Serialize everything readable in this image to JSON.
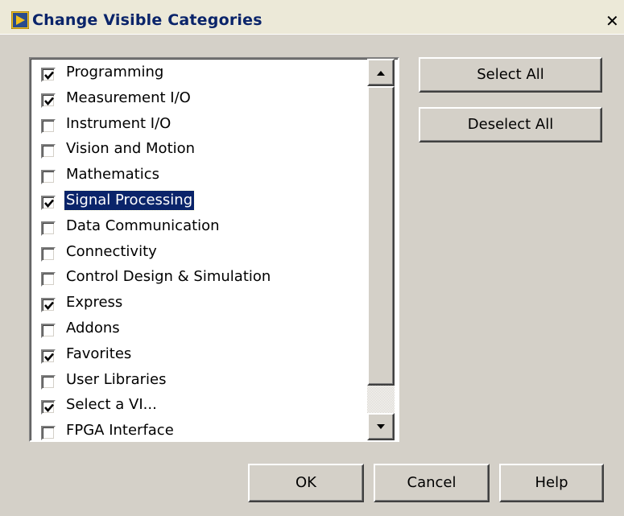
{
  "window": {
    "title": "Change Visible Categories",
    "close_glyph": "✕"
  },
  "categories": [
    {
      "label": "Programming",
      "checked": true
    },
    {
      "label": "Measurement I/O",
      "checked": true
    },
    {
      "label": "Instrument I/O",
      "checked": false
    },
    {
      "label": "Vision and Motion",
      "checked": false
    },
    {
      "label": "Mathematics",
      "checked": false
    },
    {
      "label": "Signal Processing",
      "checked": true,
      "selected": true
    },
    {
      "label": "Data Communication",
      "checked": false
    },
    {
      "label": "Connectivity",
      "checked": false
    },
    {
      "label": "Control Design & Simulation",
      "checked": false
    },
    {
      "label": "Express",
      "checked": true
    },
    {
      "label": "Addons",
      "checked": false
    },
    {
      "label": "Favorites",
      "checked": true
    },
    {
      "label": "User Libraries",
      "checked": false
    },
    {
      "label": "Select a VI...",
      "checked": true
    },
    {
      "label": "FPGA Interface",
      "checked": false
    }
  ],
  "side_buttons": {
    "select_all": "Select All",
    "deselect_all": "Deselect All"
  },
  "bottom_buttons": {
    "ok": "OK",
    "cancel": "Cancel",
    "help": "Help"
  },
  "colors": {
    "dialog_bg": "#d4d0c8",
    "selection": "#0a246a",
    "title_text": "#0a246a"
  },
  "icons": {
    "app": "labview-app-icon",
    "check": "check-icon",
    "scroll_up": "arrow-up-icon",
    "scroll_down": "arrow-down-icon",
    "close": "close-icon"
  }
}
